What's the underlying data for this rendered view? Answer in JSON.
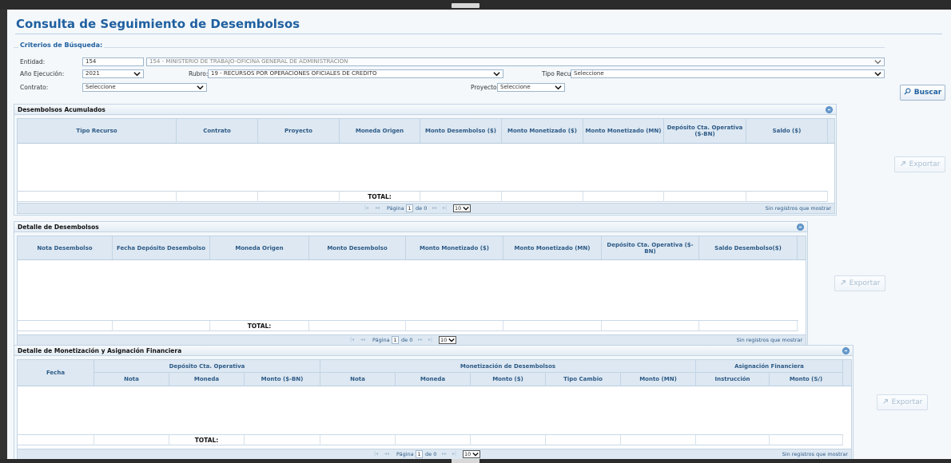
{
  "page": {
    "title": "Consulta de Seguimiento de Desembolsos"
  },
  "criteria": {
    "legend": "Criterios de Búsqueda:",
    "entidad_label": "Entidad:",
    "entidad_code": "154",
    "entidad_name": "154 - MINISTERIO DE TRABAJO-OFICINA GENERAL DE ADMINISTRACION",
    "anio_label": "Año Ejecución:",
    "anio_value": "2021",
    "rubro_label": "Rubro:",
    "rubro_value": "19 - RECURSOS POR OPERACIONES OFICIALES DE CREDITO",
    "tipo_recurso_label": "Tipo Recurso:",
    "tipo_recurso_value": "Seleccione",
    "contrato_label": "Contrato:",
    "contrato_value": "Seleccione",
    "proyecto_label": "Proyecto:",
    "proyecto_value": "Seleccione",
    "buscar_label": "Buscar"
  },
  "pager": {
    "page_label": "Página",
    "page_value": "1",
    "of_text": "de 0",
    "size_value": "10",
    "no_records": "Sin registros que mostrar",
    "first": "|◂",
    "prev": "◂◂",
    "next": "▸▸",
    "last": "▸|"
  },
  "export_label": "Exportar",
  "total_label": "TOTAL:",
  "acumulados": {
    "title": "Desembolsos Acumulados",
    "columns": [
      "Tipo Recurso",
      "Contrato",
      "Proyecto",
      "Moneda Origen",
      "Monto Desembolso ($)",
      "Monto Monetizado ($)",
      "Monto Monetizado (MN)",
      "Depósito Cta. Operativa ($-BN)",
      "Saldo ($)"
    ]
  },
  "detalle": {
    "title": "Detalle de Desembolsos",
    "columns": [
      "Nota Desembolso",
      "Fecha Depósito Desembolso",
      "Moneda Origen",
      "Monto Desembolso",
      "Monto Monetizado ($)",
      "Monto Monetizado (MN)",
      "Depósito Cta. Operativa ($-BN)",
      "Saldo Desembolso($)"
    ]
  },
  "monetizacion": {
    "title": "Detalle de Monetización y Asignación Financiera",
    "fecha": "Fecha",
    "groups": [
      "Depósito Cta. Operativa",
      "Monetización de Desembolsos",
      "Asignación Financiera"
    ],
    "columns": [
      "Nota",
      "Moneda",
      "Monto ($-BN)",
      "Nota",
      "Moneda",
      "Monto ($)",
      "Tipo Cambio",
      "Monto (MN)",
      "Instrucción",
      "Monto (S/)"
    ]
  }
}
